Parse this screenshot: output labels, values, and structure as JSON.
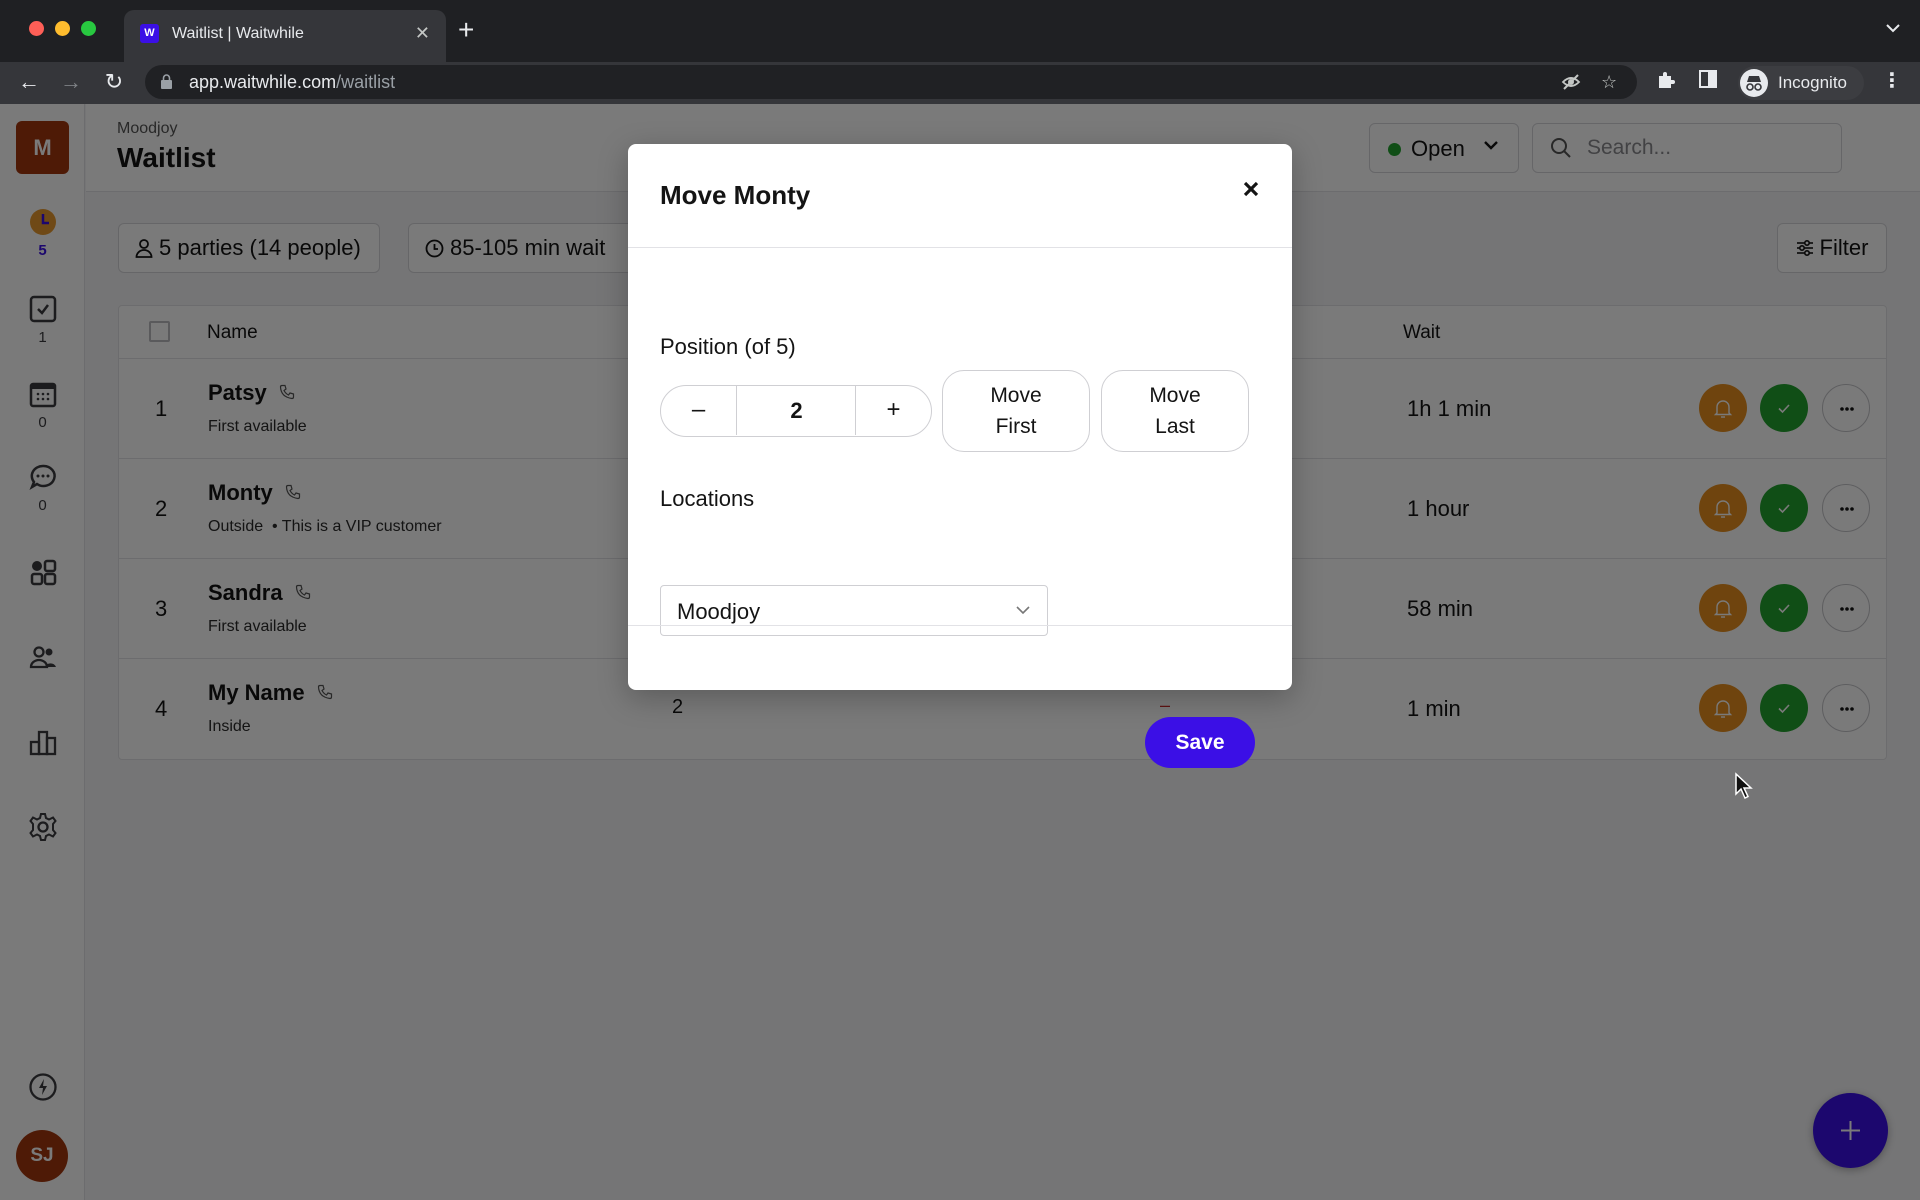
{
  "browser": {
    "tab_title": "Waitlist | Waitwhile",
    "favicon_letter": "W",
    "url_host": "app.waitwhile.com",
    "url_path": "/waitlist",
    "profile_label": "Incognito"
  },
  "sidebar": {
    "logo_letter": "M",
    "items": [
      {
        "icon": "clock-icon",
        "count": "5",
        "active": true
      },
      {
        "icon": "checkbox-icon",
        "count": "1"
      },
      {
        "icon": "calendar-icon",
        "count": "0"
      },
      {
        "icon": "chat-icon",
        "count": "0"
      },
      {
        "icon": "apps-icon"
      },
      {
        "icon": "customers-icon"
      },
      {
        "icon": "analytics-icon"
      },
      {
        "icon": "settings-icon"
      }
    ],
    "bolt_icon": "lightning-icon",
    "user_initials": "SJ"
  },
  "header": {
    "breadcrumb": "Moodjoy",
    "title": "Waitlist",
    "status_label": "Open",
    "status_color": "#22a32e",
    "search_placeholder": "Search..."
  },
  "summary": {
    "parties": "5 parties (14 people)",
    "wait": "85-105 min wait",
    "filter_label": "Filter"
  },
  "table": {
    "columns": {
      "name": "Name",
      "wait": "Wait"
    },
    "rows": [
      {
        "position": "1",
        "name": "Patsy",
        "sub": "First available",
        "wait": "1h 1 min"
      },
      {
        "position": "2",
        "name": "Monty",
        "sub": "Outside  • This is a VIP customer",
        "wait": "1 hour"
      },
      {
        "position": "3",
        "name": "Sandra",
        "sub": "First available",
        "wait": "58 min"
      },
      {
        "position": "4",
        "name": "My Name",
        "sub": "Inside",
        "size": "2",
        "dash": "–",
        "wait": "1 min"
      }
    ]
  },
  "modal": {
    "title": "Move Monty",
    "position_label": "Position (of 5)",
    "position_value": "2",
    "minus_label": "–",
    "plus_label": "+",
    "move_first_line1": "Move",
    "move_first_line2": "First",
    "move_last_line1": "Move",
    "move_last_line2": "Last",
    "locations_label": "Locations",
    "location_value": "Moodjoy",
    "save_label": "Save"
  },
  "colors": {
    "brand": "#3b0fe6",
    "notify": "#e88e1e",
    "serve": "#22a32e"
  }
}
